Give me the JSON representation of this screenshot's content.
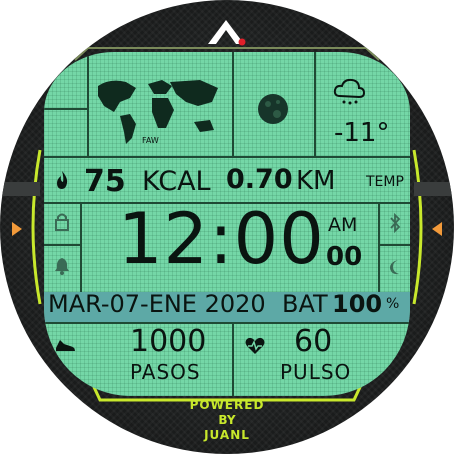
{
  "brand": {
    "logo_icon": "A-triangle-logo-icon",
    "accent": "#e0202a"
  },
  "colors": {
    "screen": "#74d7a7",
    "band": "#5da9a6",
    "rim": "#c8e82c",
    "arrow": "#f29a3a"
  },
  "map": {
    "label": "FAW"
  },
  "weather": {
    "icon": "cloud-snow-icon",
    "temperature": "-11°",
    "label": "TEMP"
  },
  "moon": {
    "icon": "moon-phase-icon"
  },
  "activity": {
    "calories": "75",
    "calories_unit": "KCAL",
    "distance": "0.70",
    "distance_unit": "KM",
    "flame_icon": "flame-icon"
  },
  "time": {
    "value": "12:00",
    "ampm": "AM",
    "seconds": "00"
  },
  "status_icons": {
    "lock": "lock-icon",
    "bell": "bell-icon",
    "bluetooth": "bluetooth-icon",
    "night": "crescent-moon-icon"
  },
  "date": {
    "text": "MAR-07-ENE 2020",
    "battery_label": "BAT",
    "battery_value": "100",
    "battery_unit": "%"
  },
  "steps": {
    "value": "1000",
    "label": "PASOS",
    "icon": "running-shoe-icon"
  },
  "pulse": {
    "value": "60",
    "label": "PULSO",
    "icon": "heart-pulse-icon"
  },
  "credits": {
    "line1": "POWERED",
    "line2": "BY",
    "line3": "JUANL"
  }
}
